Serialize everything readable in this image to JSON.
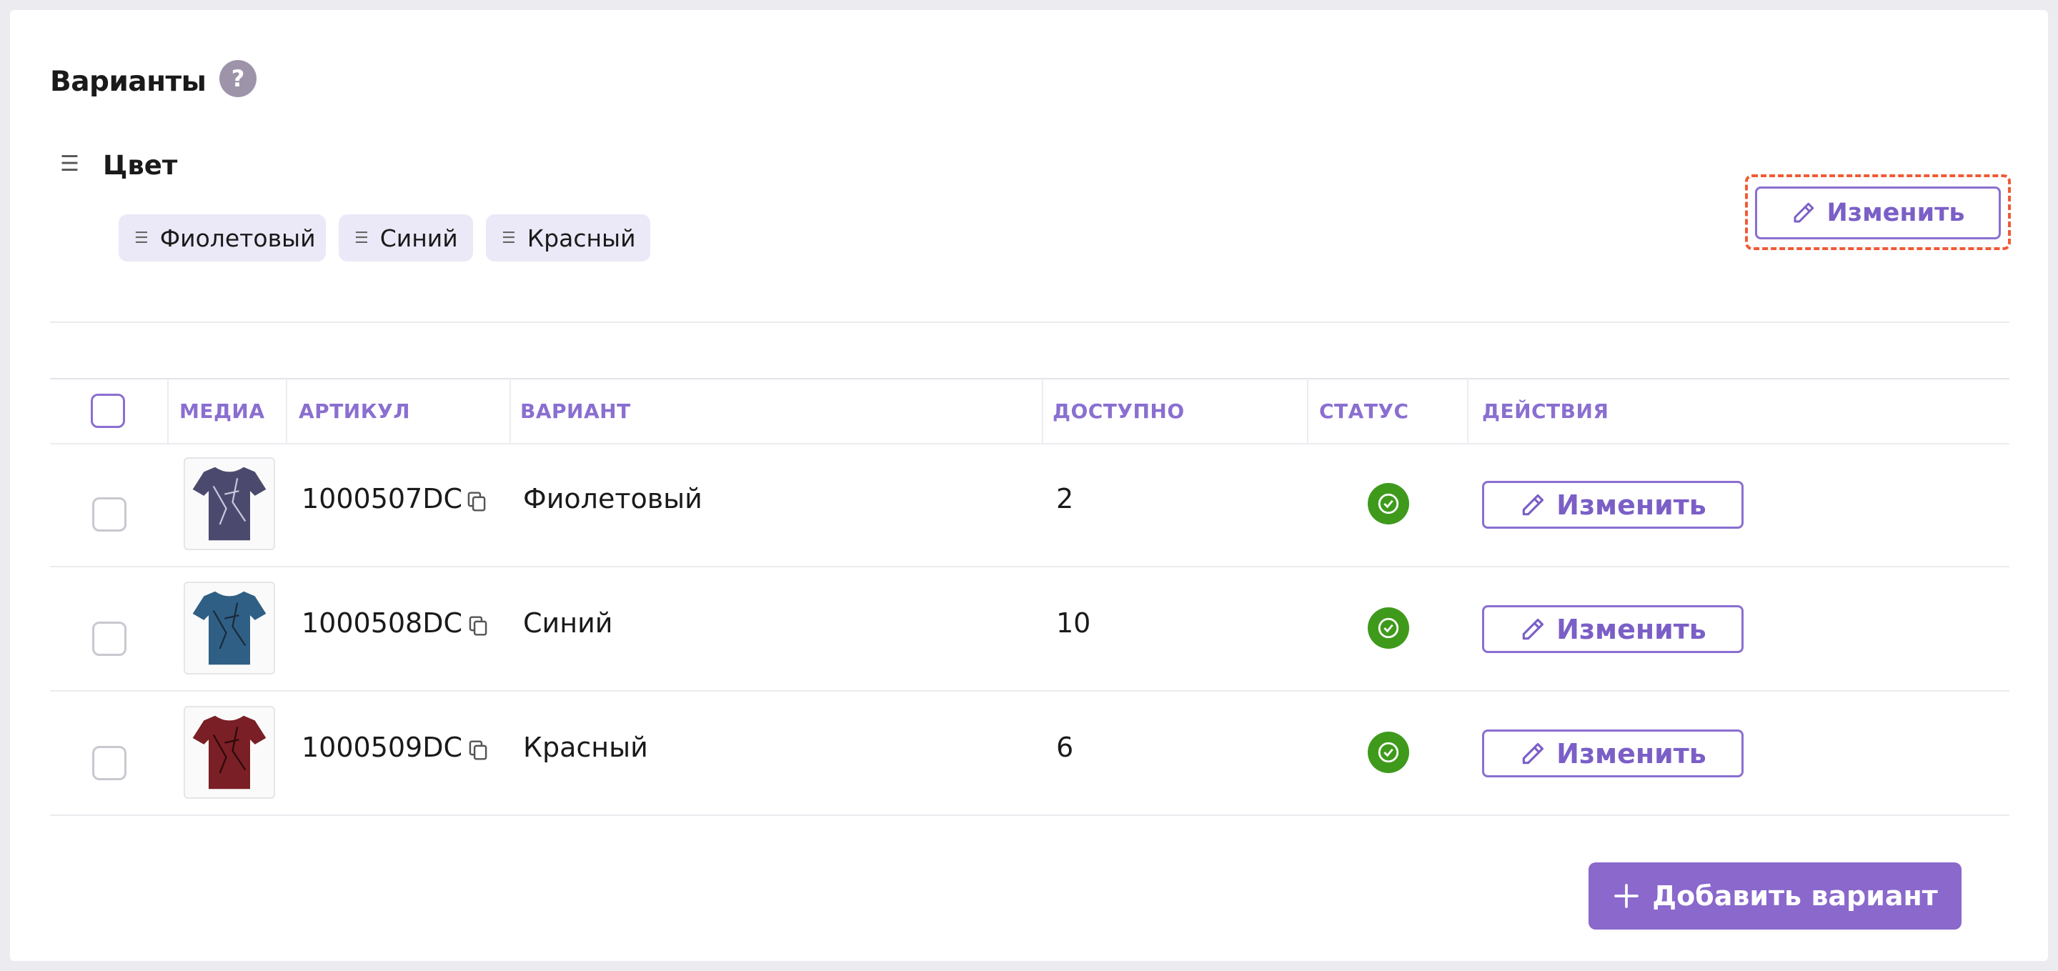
{
  "section": {
    "title": "Варианты",
    "help_glyph": "?"
  },
  "option": {
    "name": "Цвет",
    "values": [
      "Фиолетовый",
      "Синий",
      "Красный"
    ],
    "edit_label": "Изменить"
  },
  "table": {
    "headers": {
      "media": "МЕДИА",
      "sku": "АРТИКУЛ",
      "variant": "ВАРИАНТ",
      "available": "ДОСТУПНО",
      "status": "СТАТУС",
      "actions": "ДЕЙСТВИЯ"
    },
    "rows": [
      {
        "sku": "1000507DC",
        "variant": "Фиолетовый",
        "available": "2",
        "status": "active",
        "action_label": "Изменить",
        "image_color": "#4b4a6e"
      },
      {
        "sku": "1000508DC",
        "variant": "Синий",
        "available": "10",
        "status": "active",
        "action_label": "Изменить",
        "image_color": "#2f5f85"
      },
      {
        "sku": "1000509DC",
        "variant": "Красный",
        "available": "6",
        "status": "active",
        "action_label": "Изменить",
        "image_color": "#7a1f25"
      }
    ]
  },
  "footer": {
    "add_variant_label": "Добавить вариант"
  },
  "colors": {
    "accent": "#8a6fd0",
    "primary_button": "#8a68cc",
    "status_ok": "#3f9a1c",
    "highlight": "#f05a36"
  },
  "icons": {
    "help": "question-mark-icon",
    "drag": "drag-handle-icon",
    "edit": "pencil-icon",
    "copy": "copy-icon",
    "status": "check-circle-icon",
    "add": "plus-icon"
  }
}
